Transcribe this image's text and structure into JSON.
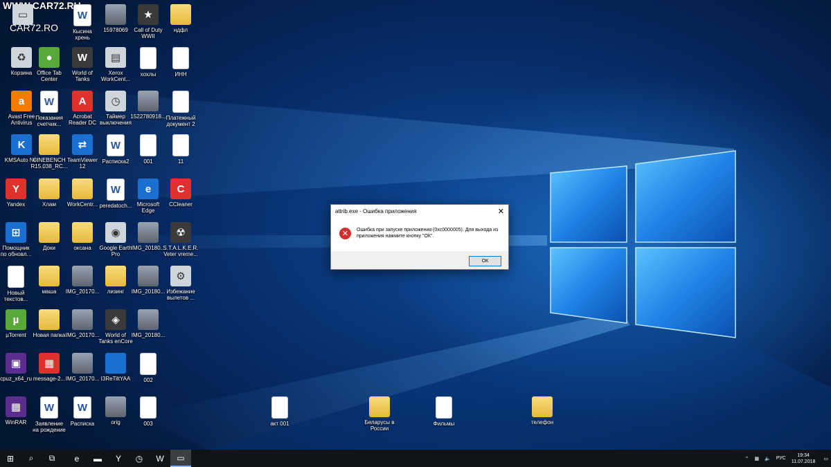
{
  "watermark": "WWW.CAR72.RU",
  "watermark_logo": "CAR72.RO",
  "icons": [
    {
      "label": "",
      "glyph": "▭",
      "style": "g-gray"
    },
    {
      "label": "Кысина\nхрень",
      "glyph": "W",
      "style": "g-word"
    },
    {
      "label": "15978069",
      "glyph": "",
      "style": "g-img"
    },
    {
      "label": "Call of Duty\nWWII",
      "glyph": "★",
      "style": "g-dark"
    },
    {
      "label": "ндфл",
      "glyph": "",
      "style": "g-folder"
    },
    {
      "label": "Корзина",
      "glyph": "♻",
      "style": "g-gray"
    },
    {
      "label": "Office Tab\nCenter",
      "glyph": "●",
      "style": "g-green"
    },
    {
      "label": "World of\nTanks",
      "glyph": "W",
      "style": "g-dark"
    },
    {
      "label": "Xerox\nWorkCent...",
      "glyph": "▤",
      "style": "g-gray"
    },
    {
      "label": "хохлы",
      "glyph": "",
      "style": "g-doc"
    },
    {
      "label": "ИНН",
      "glyph": "",
      "style": "g-doc"
    },
    {
      "label": "Avast Free\nAntivirus",
      "glyph": "a",
      "style": "g-orange"
    },
    {
      "label": "Показания\nсчетчик...",
      "glyph": "W",
      "style": "g-word"
    },
    {
      "label": "Acrobat\nReader DC",
      "glyph": "A",
      "style": "g-red"
    },
    {
      "label": "Таймер\nвыключения",
      "glyph": "◷",
      "style": "g-gray"
    },
    {
      "label": "1522780918...",
      "glyph": "",
      "style": "g-img"
    },
    {
      "label": "Платежный\nдокумент 2",
      "glyph": "",
      "style": "g-doc"
    },
    {
      "label": "KMSAuto Net",
      "glyph": "K",
      "style": "g-blue"
    },
    {
      "label": "CINEBENCH\nR15.038_RC...",
      "glyph": "",
      "style": "g-folder"
    },
    {
      "label": "TeamViewer\n12",
      "glyph": "⇄",
      "style": "g-blue"
    },
    {
      "label": "Расписка2",
      "glyph": "W",
      "style": "g-word"
    },
    {
      "label": "001",
      "glyph": "",
      "style": "g-doc"
    },
    {
      "label": "11",
      "glyph": "",
      "style": "g-doc"
    },
    {
      "label": "Yandex",
      "glyph": "Y",
      "style": "g-red"
    },
    {
      "label": "Хлам",
      "glyph": "",
      "style": "g-folder"
    },
    {
      "label": "WorkCentr...",
      "glyph": "",
      "style": "g-folder"
    },
    {
      "label": "peredatoch...",
      "glyph": "W",
      "style": "g-word"
    },
    {
      "label": "Microsoft\nEdge",
      "glyph": "e",
      "style": "g-blue"
    },
    {
      "label": "CCleaner",
      "glyph": "C",
      "style": "g-red"
    },
    {
      "label": "Помощник\nпо обновл...",
      "glyph": "⊞",
      "style": "g-blue"
    },
    {
      "label": "Доки",
      "glyph": "",
      "style": "g-folder"
    },
    {
      "label": "оксана",
      "glyph": "",
      "style": "g-folder"
    },
    {
      "label": "Google Earth\nPro",
      "glyph": "◉",
      "style": "g-gray"
    },
    {
      "label": "IMG_20180...",
      "glyph": "",
      "style": "g-img"
    },
    {
      "label": "S.T.A.L.K.E.R.\nVeter vreme...",
      "glyph": "☢",
      "style": "g-dark"
    },
    {
      "label": "Новый\nтекстов...",
      "glyph": "",
      "style": "g-doc"
    },
    {
      "label": "маша",
      "glyph": "",
      "style": "g-folder"
    },
    {
      "label": "IMG_20170...",
      "glyph": "",
      "style": "g-img"
    },
    {
      "label": "лизинг",
      "glyph": "",
      "style": "g-folder"
    },
    {
      "label": "IMG_20180...",
      "glyph": "",
      "style": "g-img"
    },
    {
      "label": "Избежание\nвылетов ...",
      "glyph": "⚙",
      "style": "g-gray"
    },
    {
      "label": "µTorrent",
      "glyph": "µ",
      "style": "g-green"
    },
    {
      "label": "Новая папка",
      "glyph": "",
      "style": "g-folder"
    },
    {
      "label": "IMG_20170...",
      "glyph": "",
      "style": "g-img"
    },
    {
      "label": "World of\nTanks enCore",
      "glyph": "◈",
      "style": "g-dark"
    },
    {
      "label": "IMG_20180...",
      "glyph": "",
      "style": "g-img"
    },
    {
      "label": "cpuz_x64_ru",
      "glyph": "▣",
      "style": "g-purple"
    },
    {
      "label": "message-2...",
      "glyph": "▦",
      "style": "g-red"
    },
    {
      "label": "IMG_20170...",
      "glyph": "",
      "style": "g-img"
    },
    {
      "label": "I3ReTiltYAA",
      "glyph": "",
      "style": "g-blue"
    },
    {
      "label": "002",
      "glyph": "",
      "style": "g-doc"
    },
    {
      "label": "WinRAR",
      "glyph": "▦",
      "style": "g-purple"
    },
    {
      "label": "Заявление\nна рождение",
      "glyph": "W",
      "style": "g-word"
    },
    {
      "label": "Расписка",
      "glyph": "W",
      "style": "g-word"
    },
    {
      "label": "orig",
      "glyph": "",
      "style": "g-img"
    },
    {
      "label": "003",
      "glyph": "",
      "style": "g-doc"
    },
    {
      "label": "акт 001",
      "glyph": "",
      "style": "g-doc"
    },
    {
      "label": "Беларусы в\nРоссии",
      "glyph": "",
      "style": "g-folder"
    },
    {
      "label": "Фильмы",
      "glyph": "",
      "style": "g-doc"
    },
    {
      "label": "телефон",
      "glyph": "",
      "style": "g-folder"
    }
  ],
  "dialog": {
    "title": "attrib.exe - Ошибка приложения",
    "close": "✕",
    "error_icon": "✕",
    "message": "Ошибка при запуске приложения (0xc0000005). Для выхода из приложения нажмите кнопку \"ОК\".",
    "ok_label": "ОК"
  },
  "taskbar": {
    "start_icon": "⊞",
    "search_icon": "⌕",
    "taskview_icon": "⧉",
    "apps": [
      {
        "name": "edge-icon",
        "glyph": "e",
        "active": false
      },
      {
        "name": "explorer-icon",
        "glyph": "▬",
        "active": false
      },
      {
        "name": "yandex-icon",
        "glyph": "Y",
        "active": false
      },
      {
        "name": "timer-icon",
        "glyph": "◷",
        "active": false
      },
      {
        "name": "tanks-icon",
        "glyph": "W",
        "active": false
      },
      {
        "name": "dialog-app-icon",
        "glyph": "▭",
        "active": true
      }
    ],
    "tray": {
      "chevron": "⌃",
      "network": "▦",
      "volume": "🔈",
      "lang": "РУС",
      "time": "19:34",
      "date": "11.07.2018",
      "notifications": "▭"
    }
  }
}
